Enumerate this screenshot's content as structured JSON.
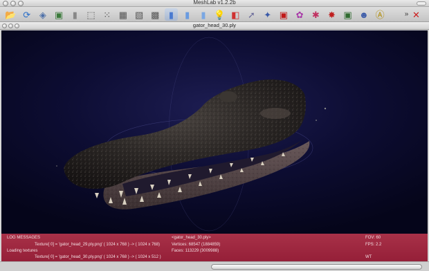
{
  "window": {
    "title": "MeshLab v1.2.2b"
  },
  "toolbar": {
    "more_label": "»",
    "buttons": [
      {
        "id": "open",
        "icon": "open-folder-icon",
        "glyph": "📂",
        "color": "#c99a22"
      },
      {
        "id": "reload",
        "icon": "reload-icon",
        "glyph": "⟳",
        "color": "#2a6fc9"
      },
      {
        "id": "save",
        "icon": "save-icon",
        "glyph": "◈",
        "color": "#4c6fa8"
      },
      {
        "id": "snapshot",
        "icon": "snapshot-icon",
        "glyph": "▣",
        "color": "#3a7a3a"
      },
      {
        "id": "bbox",
        "icon": "bounding-box-icon",
        "glyph": "▮",
        "color": "#888888"
      },
      {
        "id": "points",
        "icon": "point-cloud-icon",
        "glyph": "⬚",
        "color": "#555555"
      },
      {
        "id": "wire",
        "icon": "wireframe-icon",
        "glyph": "⁙",
        "color": "#555555"
      },
      {
        "id": "hidden",
        "icon": "hidden-lines-icon",
        "glyph": "▦",
        "color": "#555555"
      },
      {
        "id": "flatlines",
        "icon": "flat-lines-icon",
        "glyph": "▧",
        "color": "#555555"
      },
      {
        "id": "flat",
        "icon": "flat-shading-icon",
        "glyph": "▩",
        "color": "#555555"
      },
      {
        "id": "smooth",
        "icon": "smooth-shading-icon",
        "glyph": "▮",
        "color": "#4a7ad0",
        "selected": true
      },
      {
        "id": "texture",
        "icon": "texture-icon",
        "glyph": "▮",
        "color": "#6a9be0"
      },
      {
        "id": "color",
        "icon": "vertex-color-icon",
        "glyph": "▮",
        "color": "#7aa7e3"
      },
      {
        "id": "light",
        "icon": "light-bulb-icon",
        "glyph": "💡",
        "color": "#777777"
      },
      {
        "id": "backface",
        "icon": "backface-icon",
        "glyph": "◧",
        "color": "#d03030"
      },
      {
        "id": "select",
        "icon": "select-pointer-icon",
        "glyph": "➚",
        "color": "#6a6a9a"
      },
      {
        "id": "measure",
        "icon": "measure-tool-icon",
        "glyph": "✦",
        "color": "#3a5aa8"
      },
      {
        "id": "paint",
        "icon": "paint-tool-icon",
        "glyph": "▣",
        "color": "#c01818"
      },
      {
        "id": "colorize",
        "icon": "colorize-icon",
        "glyph": "✿",
        "color": "#a83aa8"
      },
      {
        "id": "selfaces",
        "icon": "select-faces-icon",
        "glyph": "✱",
        "color": "#c03060"
      },
      {
        "id": "selverts",
        "icon": "select-vertices-icon",
        "glyph": "✸",
        "color": "#c02020"
      },
      {
        "id": "align",
        "icon": "align-tool-icon",
        "glyph": "▣",
        "color": "#2f6b2f"
      },
      {
        "id": "user",
        "icon": "user-person-icon",
        "glyph": "☻",
        "color": "#3a5aa8"
      },
      {
        "id": "annotate",
        "icon": "annotate-a-icon",
        "glyph": "Ⓐ",
        "color": "#b08a00"
      },
      {
        "id": "close",
        "icon": "close-x-icon",
        "glyph": "✕",
        "color": "#cc1c1c"
      }
    ]
  },
  "document": {
    "title": "gator_head_30.ply"
  },
  "log": {
    "header": "LOG MESSAGES",
    "line1": "Texture[  0] =  'gator_head_29.ply.png' (  1024 x   768 ) -> (  1024 x   768)",
    "loading": "Loading textures",
    "line2": "Texture[  0] =  'gator_head_30.ply.png' (  1024 x   768 ) -> (  1024 x   512 )",
    "filename": "<gator_head_30.ply>",
    "vertices": "Vertices: 68547 (1884859)",
    "faces": "Faces: 113229 (3009988)",
    "fov": "FOV: 60",
    "fps": "FPS:   2.2",
    "mode": "WT"
  }
}
